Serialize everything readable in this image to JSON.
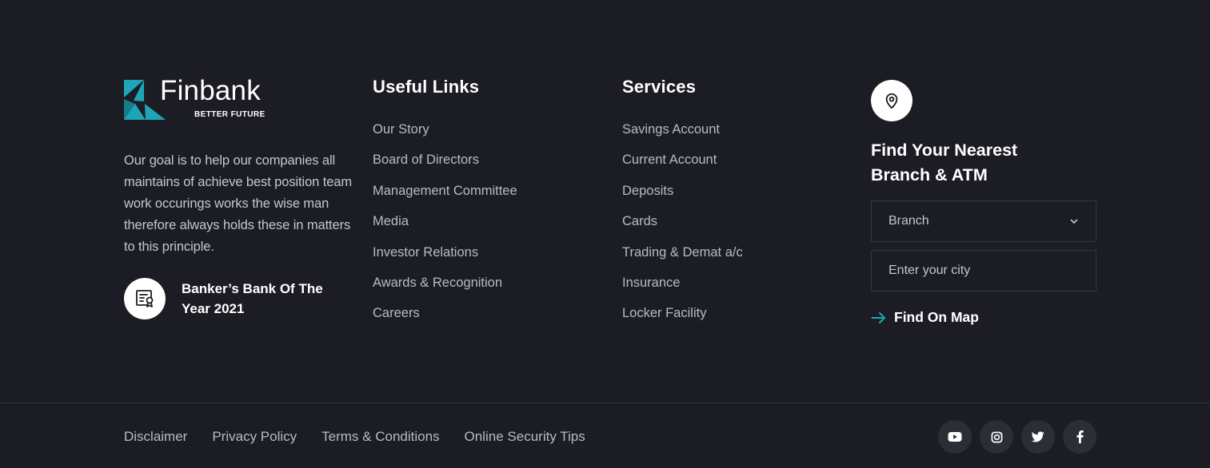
{
  "brand": {
    "name": "Finbank",
    "tagline": "BETTER FUTURE",
    "colors": {
      "accent": "#1fa5b8",
      "accent_dark": "#147d8c",
      "background": "#1c1d24"
    }
  },
  "about": {
    "description": "Our goal is to help our companies all maintains of achieve best position team work occurings works the wise man therefore always holds these in matters to this principle.",
    "award_icon": "certificate-icon",
    "award_title": "Banker’s Bank Of The Year 2021"
  },
  "useful_links": {
    "title": "Useful Links",
    "items": [
      "Our Story",
      "Board of Directors",
      "Management Committee",
      "Media",
      "Investor Relations",
      "Awards & Recognition",
      "Careers"
    ]
  },
  "services": {
    "title": "Services",
    "items": [
      "Savings Account",
      "Current Account",
      "Deposits",
      "Cards",
      "Trading & Demat a/c",
      "Insurance",
      "Locker Facility"
    ]
  },
  "branch_finder": {
    "icon": "map-pin-icon",
    "title": "Find Your Nearest Branch & ATM",
    "select_value": "Branch",
    "city_placeholder": "Enter your city",
    "find_label": "Find On Map",
    "find_icon": "arrow-right-icon"
  },
  "bottom_bar": {
    "links": [
      "Disclaimer",
      "Privacy Policy",
      "Terms & Conditions",
      "Online Security Tips"
    ],
    "social": [
      "youtube-icon",
      "instagram-icon",
      "twitter-icon",
      "facebook-icon"
    ]
  }
}
